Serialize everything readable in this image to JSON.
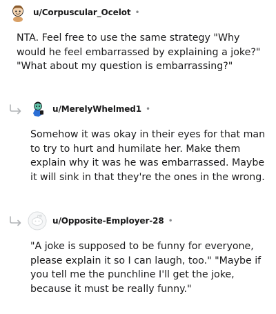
{
  "comments": [
    {
      "username": "u/Corpuscular_Ocelot",
      "separator": "•",
      "avatar_icon": "snoo-avatar-icon",
      "body": "NTA. Feel free to use the same strategy \"Why would he feel embarrassed by explaining a joke?\" \"What about my question is embarrassing?\""
    },
    {
      "username": "u/MerelyWhelmed1",
      "separator": "•",
      "avatar_icon": "snoo-avatar-icon",
      "reply_icon": "reply-arrow-icon",
      "body": "Somehow it was okay in their eyes for that man to try to hurt and humilate her. Make them explain why it was he was embarrassed. Maybe it will sink in that they're the ones in the wrong."
    },
    {
      "username": "u/Opposite-Employer-28",
      "separator": "•",
      "avatar_icon": "default-avatar-icon",
      "reply_icon": "reply-arrow-icon",
      "body": "\"A joke is supposed to be funny for everyone, please explain it so I can laugh, too.\" \"Maybe if you tell me the punchline I'll get the joke, because it must be really funny.\""
    }
  ]
}
